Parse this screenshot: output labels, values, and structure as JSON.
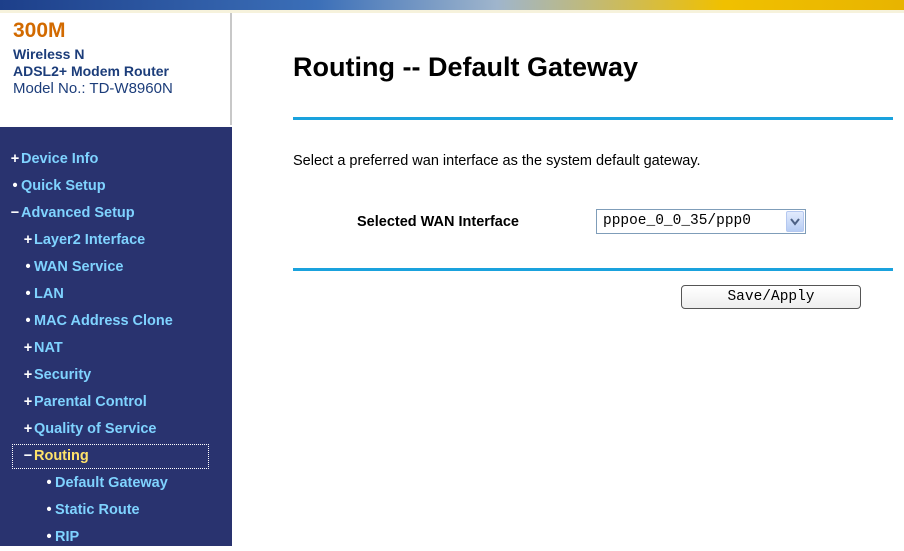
{
  "brand": {
    "model_big": "300M",
    "line1": "Wireless N",
    "line2": "ADSL2+ Modem Router",
    "model_no": "Model No.: TD-W8960N"
  },
  "menu": [
    {
      "bullet": "+",
      "label": "Device Info"
    },
    {
      "bullet": "•",
      "label": "Quick Setup"
    },
    {
      "bullet": "−",
      "label": "Advanced Setup"
    },
    {
      "bullet": "+",
      "label": "Layer2 Interface"
    },
    {
      "bullet": "•",
      "label": "WAN Service"
    },
    {
      "bullet": "•",
      "label": "LAN"
    },
    {
      "bullet": "•",
      "label": "MAC Address Clone"
    },
    {
      "bullet": "+",
      "label": "NAT"
    },
    {
      "bullet": "+",
      "label": "Security"
    },
    {
      "bullet": "+",
      "label": "Parental Control"
    },
    {
      "bullet": "+",
      "label": "Quality of Service"
    },
    {
      "bullet": "−",
      "label": "Routing"
    },
    {
      "bullet": "•",
      "label": "Default Gateway"
    },
    {
      "bullet": "•",
      "label": "Static Route"
    },
    {
      "bullet": "•",
      "label": "RIP"
    }
  ],
  "main": {
    "title": "Routing -- Default Gateway",
    "description": "Select a preferred wan interface as the system default gateway.",
    "wan_label": "Selected WAN Interface",
    "wan_selected": "pppoe_0_0_35/ppp0",
    "save_label": "Save/Apply"
  },
  "colors": {
    "sidebar_bg": "#29336f",
    "menu_text": "#7fd3ff",
    "menu_active": "#ffe36a",
    "rule": "#1aa2dd",
    "brand_orange": "#d26a00"
  }
}
